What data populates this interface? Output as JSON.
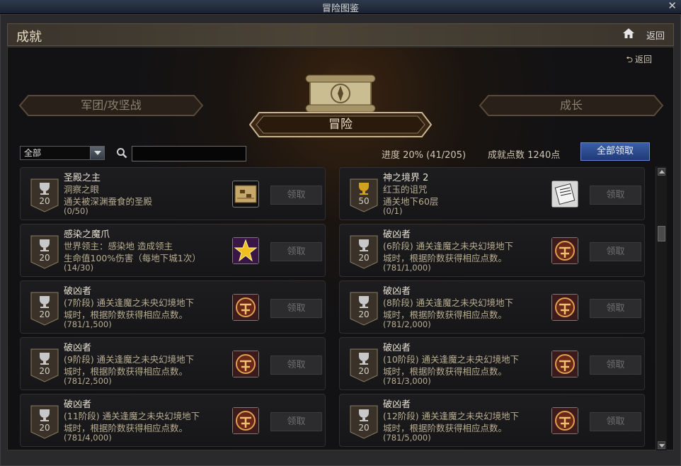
{
  "window": {
    "title": "冒险图鉴",
    "close_glyph": "✕"
  },
  "header": {
    "title": "成就",
    "back_label": "返回"
  },
  "panel": {
    "sub_back_label": "返回"
  },
  "tabs": {
    "left": "军团/攻坚战",
    "center": "冒险",
    "right": "成长"
  },
  "filter": {
    "selected": "全部",
    "search_value": ""
  },
  "progress": {
    "text": "进度 20% (41/205)",
    "percent": 20
  },
  "points": {
    "text": "成就点数 1240点"
  },
  "claim_all_label": "全部领取",
  "colors": {
    "accent_blue": "#2f4f94",
    "gold_text": "#e8dcc4",
    "muted_text": "#b9ad92"
  },
  "achievements": [
    {
      "title": "圣殿之主",
      "line2": "洞察之眼",
      "line3": "通关被深渊蚕食的圣殿",
      "progress": "(0/50)",
      "points": "20",
      "badge": "silver",
      "icon": "map-scroll-icon",
      "claim": "领取"
    },
    {
      "title": "神之境界 2",
      "line2": "红玉的诅咒",
      "line3": "通关地下60层",
      "progress": "(0/1)",
      "points": "50",
      "badge": "gold",
      "icon": "paper-scroll-icon",
      "claim": "领取"
    },
    {
      "title": "感染之魔爪",
      "line2": "世界领主：感染地          造成领主",
      "line3": "生命值100%伤害（每地下城1次）",
      "progress": "(14/30)",
      "points": "20",
      "badge": "silver",
      "icon": "golden-star-icon",
      "claim": "领取"
    },
    {
      "title": "破凶者",
      "line2": "(6阶段) 通关逢魔之未央幻境地下",
      "line3": "城时，根据阶数获得相应点数。",
      "progress": "(781/1,000)",
      "points": "20",
      "badge": "silver",
      "icon": "demon-emblem-icon",
      "claim": "领取"
    },
    {
      "title": "破凶者",
      "line2": "(7阶段) 通关逢魔之未央幻境地下",
      "line3": "城时，根据阶数获得相应点数。",
      "progress": "(781/1,500)",
      "points": "20",
      "badge": "silver",
      "icon": "demon-emblem-icon",
      "claim": "领取"
    },
    {
      "title": "破凶者",
      "line2": "(8阶段) 通关逢魔之未央幻境地下",
      "line3": "城时，根据阶数获得相应点数。",
      "progress": "(781/2,000)",
      "points": "20",
      "badge": "silver",
      "icon": "demon-emblem-icon",
      "claim": "领取"
    },
    {
      "title": "破凶者",
      "line2": "(9阶段) 通关逢魔之未央幻境地下",
      "line3": "城时，根据阶数获得相应点数。",
      "progress": "(781/2,500)",
      "points": "20",
      "badge": "silver",
      "icon": "demon-emblem-icon",
      "claim": "领取"
    },
    {
      "title": "破凶者",
      "line2": "(10阶段) 通关逢魔之未央幻境地下",
      "line3": "城时，根据阶数获得相应点数。",
      "progress": "(781/3,000)",
      "points": "20",
      "badge": "silver",
      "icon": "demon-emblem-icon",
      "claim": "领取"
    },
    {
      "title": "破凶者",
      "line2": "(11阶段) 通关逢魔之未央幻境地下",
      "line3": "城时，根据阶数获得相应点数。",
      "progress": "(781/4,000)",
      "points": "20",
      "badge": "silver",
      "icon": "demon-emblem-icon",
      "claim": "领取"
    },
    {
      "title": "破凶者",
      "line2": "(12阶段) 通关逢魔之未央幻境地下",
      "line3": "城时，根据阶数获得相应点数。",
      "progress": "(781/5,000)",
      "points": "20",
      "badge": "silver",
      "icon": "demon-emblem-icon",
      "claim": "领取"
    }
  ]
}
